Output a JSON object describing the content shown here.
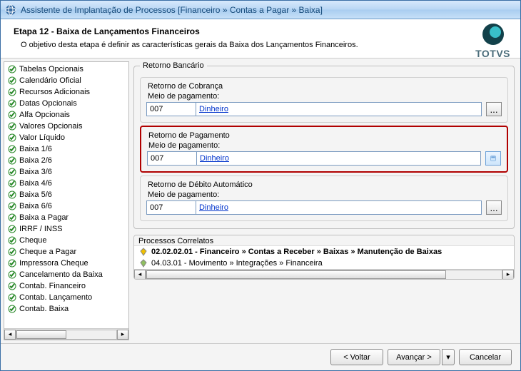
{
  "window": {
    "title": "Assistente de Implantação de Processos [Financeiro » Contas a Pagar » Baixa]"
  },
  "header": {
    "step_title": "Etapa 12 - Baixa de Lançamentos Financeiros",
    "step_desc": "O objetivo desta etapa é definir as características gerais da Baixa dos Lançamentos Financeiros.",
    "brand": "TOTVS"
  },
  "sidebar": {
    "items": [
      "Tabelas Opcionais",
      "Calendário Oficial",
      "Recursos Adicionais",
      "Datas Opcionais",
      "Alfa Opcionais",
      "Valores Opcionais",
      "Valor Líquido",
      "Baixa 1/6",
      "Baixa 2/6",
      "Baixa 3/6",
      "Baixa 4/6",
      "Baixa 5/6",
      "Baixa 6/6",
      "Baixa a Pagar",
      "IRRF / INSS",
      "Cheque",
      "Cheque a Pagar",
      "Impressora Cheque",
      "Cancelamento da Baixa",
      "Contab. Financeiro",
      "Contab. Lançamento",
      "Contab. Baixa"
    ]
  },
  "main": {
    "group_title": "Retorno Bancário",
    "sub1_title": "Retorno de Cobrança",
    "sub2_title": "Retorno de Pagamento",
    "sub3_title": "Retorno de Débito Automático",
    "field_label": "Meio de pagamento:",
    "code": "007",
    "desc": "Dinheiro",
    "lookup_label": "...",
    "correlatos_title": "Processos Correlatos",
    "correlatos": [
      "02.02.02.01 - Financeiro » Contas a Receber » Baixas » Manutenção de Baixas",
      "04.03.01 - Movimento » Integrações » Financeira"
    ]
  },
  "footer": {
    "back": "< Voltar",
    "next": "Avançar >",
    "drop": "▾",
    "cancel": "Cancelar"
  }
}
